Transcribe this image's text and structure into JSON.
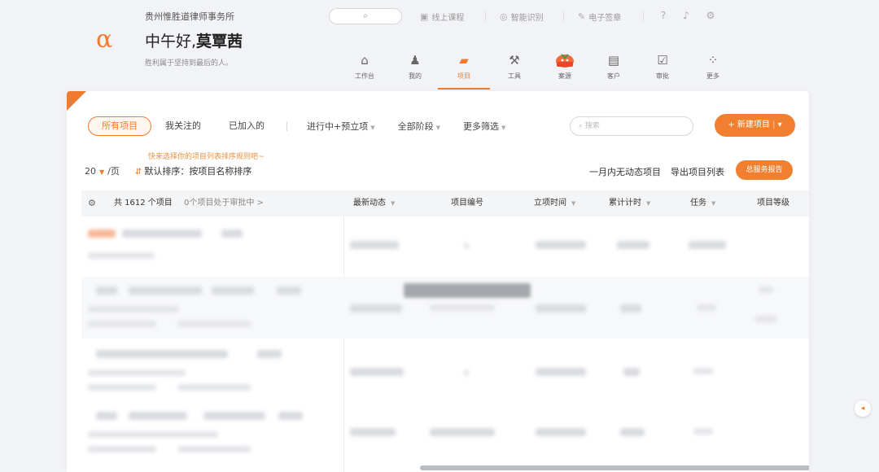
{
  "header": {
    "firm_name": "贵州惟胜道律师事务所",
    "greeting_prefix": "中午好,",
    "user_name": "莫覃茜",
    "motto": "胜利属于坚持到最后的人。",
    "search_icon": "search-icon",
    "utils": [
      {
        "icon": "play-icon",
        "label": "线上课程"
      },
      {
        "icon": "brain-icon",
        "label": "智能识别"
      },
      {
        "icon": "pen-icon",
        "label": "电子签章"
      }
    ]
  },
  "nav": {
    "items": [
      {
        "label": "工作台",
        "icon": "home-icon"
      },
      {
        "label": "我的",
        "icon": "user-icon"
      },
      {
        "label": "项目",
        "icon": "briefcase-icon"
      },
      {
        "label": "工具",
        "icon": "tools-icon"
      },
      {
        "label": "案源",
        "icon": "gift-icon"
      },
      {
        "label": "客户",
        "icon": "client-icon"
      },
      {
        "label": "审批",
        "icon": "approve-icon"
      },
      {
        "label": "更多",
        "icon": "grid-icon"
      }
    ],
    "active": "项目",
    "accent": "#f07b2e"
  },
  "filters": {
    "tabs": [
      "所有项目",
      "我关注的",
      "已加入的"
    ],
    "status": "进行中+预立项",
    "stage": "全部阶段",
    "more": "更多筛选",
    "search_placeholder": "搜索",
    "new_button": "+ 新建项目"
  },
  "toolbar": {
    "sort_hint": "快来选择你的项目列表排序规则吧~",
    "per_page": "20",
    "per_page_unit": "/页",
    "sort_label": "默认排序：按项目名称排序",
    "no_activity_link": "一月内无动态项目",
    "export_link": "导出项目列表",
    "report_button": "总服务报告"
  },
  "table": {
    "total": "共 1612 个项目",
    "pending": "0个项目处于审批中 >",
    "columns": [
      {
        "label": "最新动态"
      },
      {
        "label": "项目编号"
      },
      {
        "label": "立项时间"
      },
      {
        "label": "累计计时"
      },
      {
        "label": "任务"
      },
      {
        "label": "项目等级"
      }
    ]
  }
}
